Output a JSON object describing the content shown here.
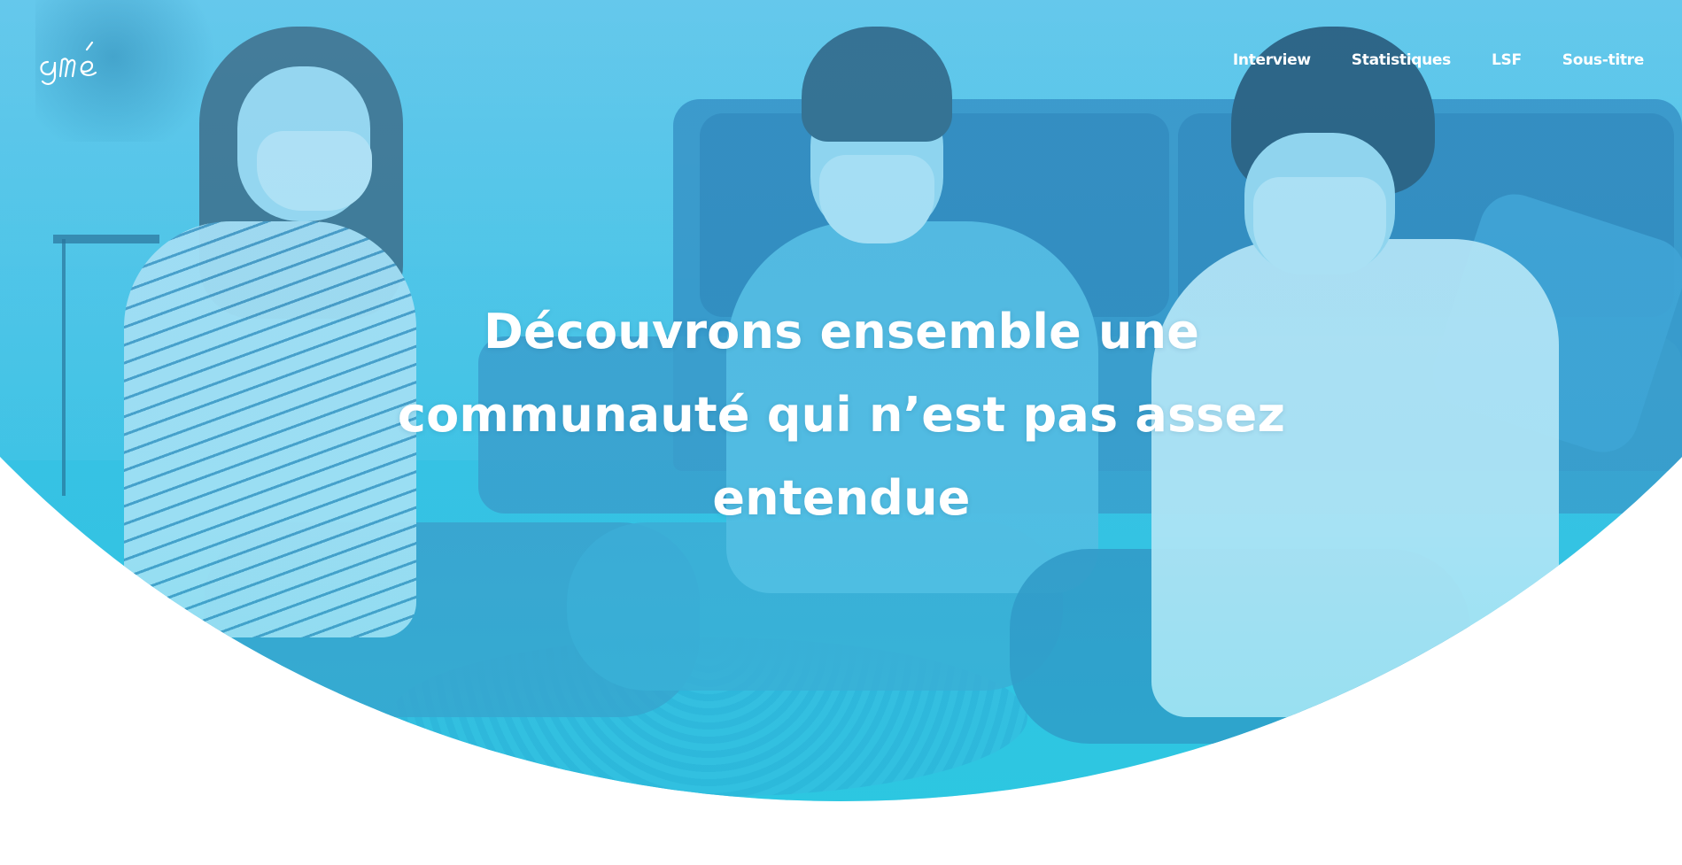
{
  "header": {
    "logo_text": "amé",
    "nav": [
      {
        "label": "Interview"
      },
      {
        "label": "Statistiques"
      },
      {
        "label": "LSF"
      },
      {
        "label": "Sous-titre"
      }
    ]
  },
  "hero": {
    "headline": "Découvrons ensemble une communauté qui n’est pas assez entendue",
    "image_icon": "hero-photo",
    "colors": {
      "overlay_top": "#4ab6e8",
      "overlay_bottom": "#2ec7e0",
      "text": "#ffffff",
      "background": "#ffffff"
    }
  }
}
